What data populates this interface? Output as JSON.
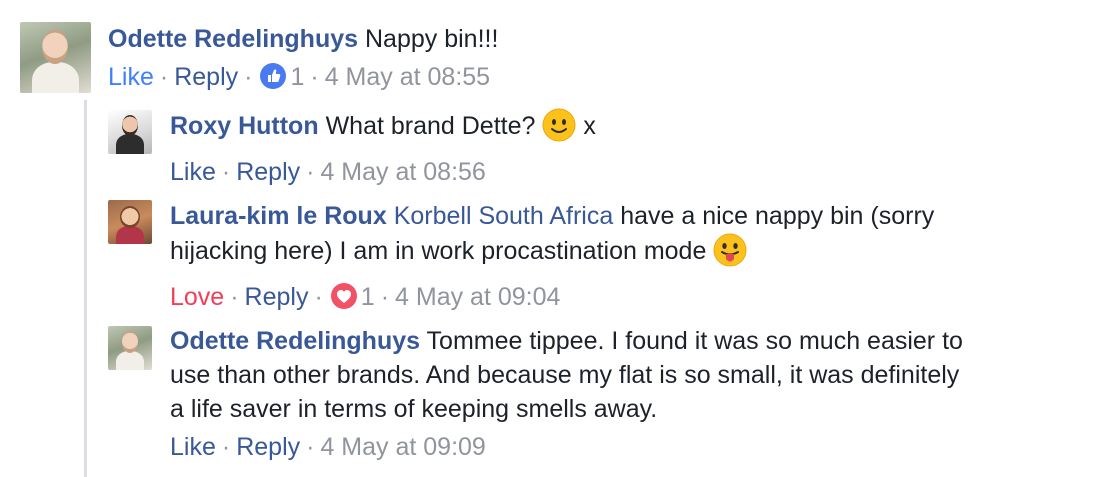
{
  "comments": [
    {
      "author": "Odette Redelinghuys",
      "text": "Nappy bin!!!",
      "action": "Like",
      "reply": "Reply",
      "reaction_count": "1",
      "time": "4 May at 08:55"
    },
    {
      "author": "Roxy Hutton",
      "text": "What brand Dette?",
      "text_after_emoji": "x",
      "action": "Like",
      "reply": "Reply",
      "time": "4 May at 08:56",
      "emoji": "slightly-smiling-face"
    },
    {
      "author": "Laura-kim le Roux",
      "mention": "Korbell South Africa",
      "text_line1": "have a nice nappy bin (sorry",
      "text_line2": "hijacking here) I am in work procastination mode",
      "action": "Love",
      "reply": "Reply",
      "reaction_count": "1",
      "time": "4 May at 09:04",
      "emoji": "face-with-tongue"
    },
    {
      "author": "Odette Redelinghuys",
      "text_line1": "Tommee tippee. I found it was so much easier to",
      "text_line2": "use than other brands. And because my flat is so small, it was definitely",
      "text_line3": "a life saver in terms of keeping smells away.",
      "action": "Like",
      "reply": "Reply",
      "time": "4 May at 09:09"
    }
  ],
  "separator": "·",
  "colors": {
    "name": "#385898",
    "meta": "#90949c",
    "like_active": "#4080ff",
    "love_active": "#f33e58",
    "thread_line": "#dadde1"
  },
  "icons": {
    "like_reaction": "thumbs-up-icon",
    "love_reaction": "heart-icon"
  }
}
